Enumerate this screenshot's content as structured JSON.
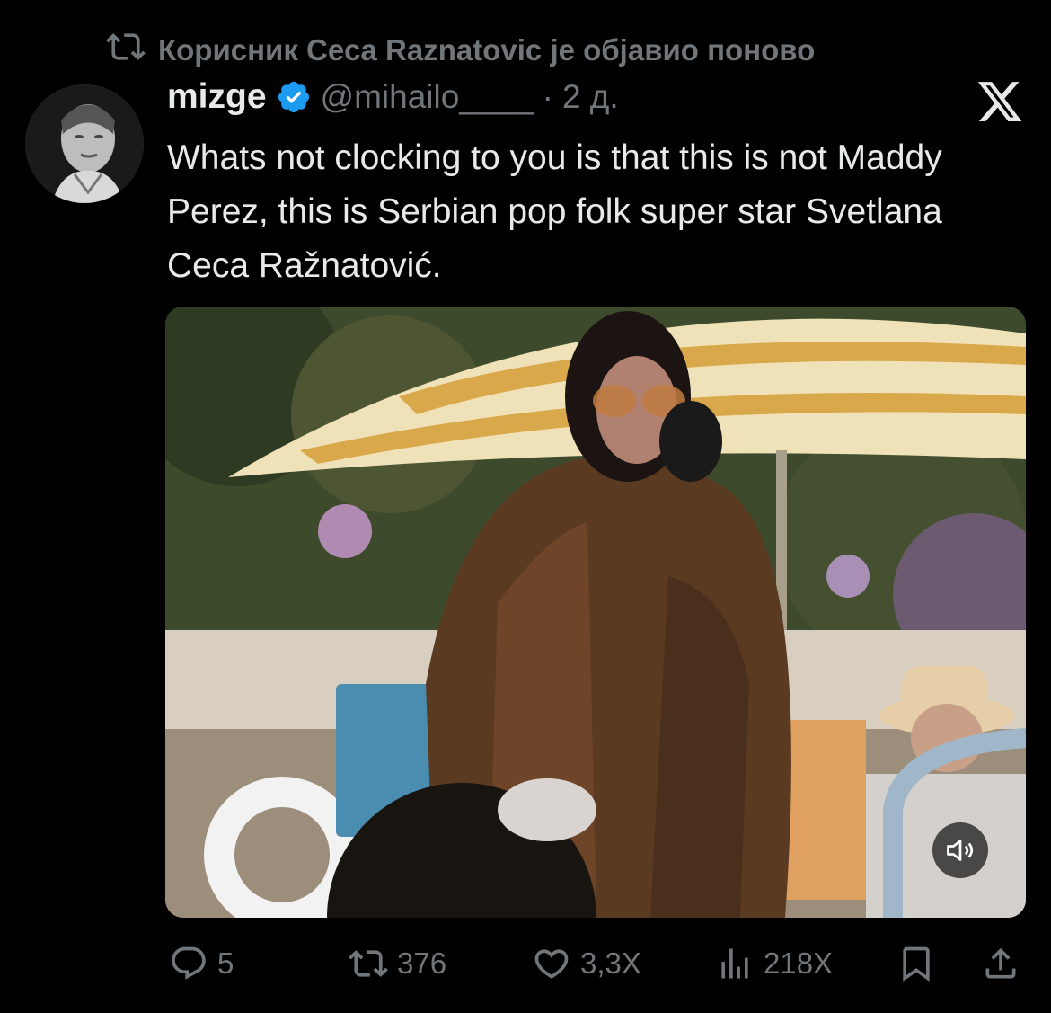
{
  "repost": {
    "icon": "repost-icon",
    "text": "Корисник Ceca Raznatovic је објавио поново"
  },
  "tweet": {
    "author_name": "mizge",
    "verified": true,
    "handle": "@mihailo____",
    "separator": "·",
    "time": "2 д.",
    "text": "Whats not clocking to you is that this is not Maddy Perez, this is Serbian pop folk super star Svetlana Ceca Ražnatović."
  },
  "media": {
    "type": "video",
    "mute_icon": "speaker-muted-icon"
  },
  "actions": {
    "replies": "5",
    "reposts": "376",
    "likes": "3,3Х",
    "views": "218Х"
  },
  "colors": {
    "background": "#000000",
    "text": "#e7e9ea",
    "muted": "#71767b",
    "verified": "#1d9bf0"
  }
}
